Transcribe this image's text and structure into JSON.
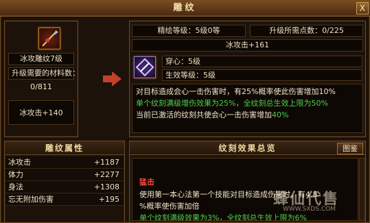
{
  "window": {
    "title": "雕纹",
    "close_label": "X"
  },
  "left_panel": {
    "item_name": "冰攻雕纹7级",
    "materials_label": "升级需要的材料数：",
    "materials_value": "0/811",
    "attack_bonus": "冰攻击+140"
  },
  "top_panel": {
    "craft_level_label": "精绘等级：5级0等",
    "points_label": "升级所需点数：0/225",
    "attack_value": "冰攻击+161",
    "rune_name": "穿心：5级",
    "active_level": "生效等级：5级",
    "description": [
      {
        "text": "对目标造成会心一击伤害时，有25%概率使此伤害增加10%",
        "color": "#f0e4c8"
      },
      {
        "text": "单个纹刻满级增伤效果为25%，全纹刻总生效上限为50%",
        "color": "#4ad04a"
      },
      {
        "text": "当前已激活的纹刻共使会心一击伤害增加",
        "color": "#f0e4c8",
        "suffix": "40%",
        "suffix_color": "#4ad04a"
      }
    ]
  },
  "attributes": {
    "title": "雕纹属性",
    "rows": [
      {
        "name": "冰攻击",
        "value": "+1187"
      },
      {
        "name": "体力",
        "value": "+2277"
      },
      {
        "name": "身法",
        "value": "+1308"
      },
      {
        "name": "忘无附加伤害",
        "value": "+195"
      }
    ]
  },
  "overview": {
    "title": "纹刻效果总览",
    "button_label": "图鉴",
    "entry_name": "猛击",
    "entry_lines": [
      "使用第一本心法第一个技能对目标造成伤害时，有4.8",
      "%概率使伤害加倍"
    ],
    "entry_note": "单个纹刻满级效果为3%，全纹刻总生效上限为6%"
  },
  "watermark": {
    "text": "蜂仙代售",
    "sub": "WWW.SXDS.COM"
  },
  "colors": {
    "accent": "#c2402a",
    "green": "#4ad04a",
    "red": "#ff4a3a",
    "border": "#6b4a24"
  }
}
